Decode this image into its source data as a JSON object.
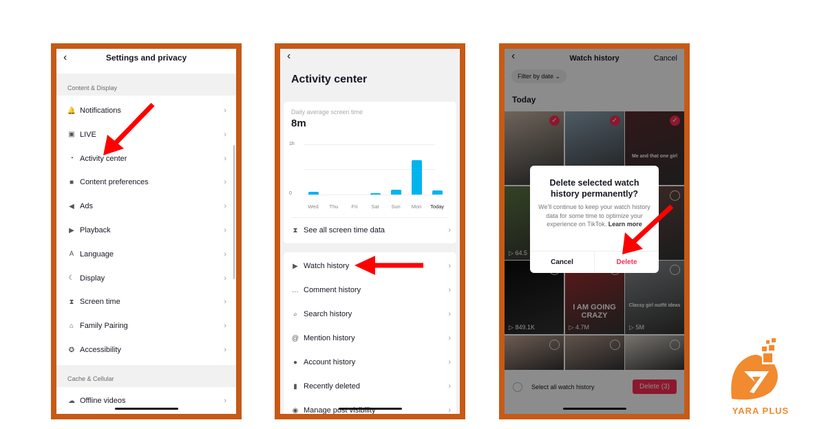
{
  "panel1": {
    "title": "Settings and privacy",
    "section1": "Content & Display",
    "items": [
      {
        "label": "Notifications",
        "icon": "bell"
      },
      {
        "label": "LIVE",
        "icon": "tv"
      },
      {
        "label": "Activity center",
        "icon": "clock"
      },
      {
        "label": "Content preferences",
        "icon": "video"
      },
      {
        "label": "Ads",
        "icon": "megaphone"
      },
      {
        "label": "Playback",
        "icon": "play"
      },
      {
        "label": "Language",
        "icon": "language"
      },
      {
        "label": "Display",
        "icon": "moon"
      },
      {
        "label": "Screen time",
        "icon": "hourglass"
      },
      {
        "label": "Family Pairing",
        "icon": "home"
      },
      {
        "label": "Accessibility",
        "icon": "accessibility"
      }
    ],
    "section2": "Cache & Cellular",
    "items2": [
      {
        "label": "Offline videos",
        "icon": "cloud"
      }
    ]
  },
  "panel2": {
    "title": "Activity center",
    "screen_time_label": "Daily average screen time",
    "screen_time_value": "8m",
    "see_all": "See all screen time data",
    "items": [
      {
        "label": "Watch history",
        "icon": "play-circle"
      },
      {
        "label": "Comment history",
        "icon": "comment"
      },
      {
        "label": "Search history",
        "icon": "search"
      },
      {
        "label": "Mention history",
        "icon": "at"
      },
      {
        "label": "Account history",
        "icon": "person"
      },
      {
        "label": "Recently deleted",
        "icon": "trash"
      },
      {
        "label": "Manage post visibility",
        "icon": "eye"
      }
    ]
  },
  "chart_data": {
    "type": "bar",
    "categories": [
      "Wed",
      "Thu",
      "Fri",
      "Sat",
      "Sun",
      "Mon",
      "Today"
    ],
    "values": [
      3,
      0,
      0,
      1.5,
      6,
      41,
      5
    ],
    "unit": "minutes",
    "yticks": [
      "0",
      "1h"
    ],
    "ylim": [
      0,
      60
    ],
    "color": "#00b4ee",
    "grid": true
  },
  "panel3": {
    "title": "Watch history",
    "cancel": "Cancel",
    "filter": "Filter by date",
    "section": "Today",
    "thumbs": [
      {
        "checked": true,
        "views": ""
      },
      {
        "checked": true,
        "views": "",
        "caption": ""
      },
      {
        "checked": true,
        "views": "",
        "caption": "Me and that one girl"
      },
      {
        "checked": false,
        "views": "64.5"
      },
      {
        "checked": false,
        "views": ""
      },
      {
        "checked": false,
        "views": ""
      },
      {
        "checked": false,
        "views": "849.1K"
      },
      {
        "checked": false,
        "views": "4.7M",
        "caption": "I AM GOING CRAZY"
      },
      {
        "checked": false,
        "views": "5M",
        "caption": "Classy girl outfit ideas"
      },
      {
        "checked": false,
        "views": ""
      },
      {
        "checked": false,
        "views": ""
      },
      {
        "checked": false,
        "views": ""
      }
    ],
    "select_all": "Select all watch history",
    "delete_button": "Delete (3)",
    "dialog": {
      "title": "Delete selected watch history permanently?",
      "body": "We'll continue to keep your watch history data for some time to optimize your experience on TikTok.",
      "learn_more": "Learn more",
      "cancel": "Cancel",
      "delete": "Delete"
    }
  },
  "logo": {
    "text": "YARA PLUS",
    "color": "#f28a30"
  },
  "colors": {
    "frame": "#c65a16",
    "accent": "#fe2c55",
    "arrow": "#ff0000"
  }
}
